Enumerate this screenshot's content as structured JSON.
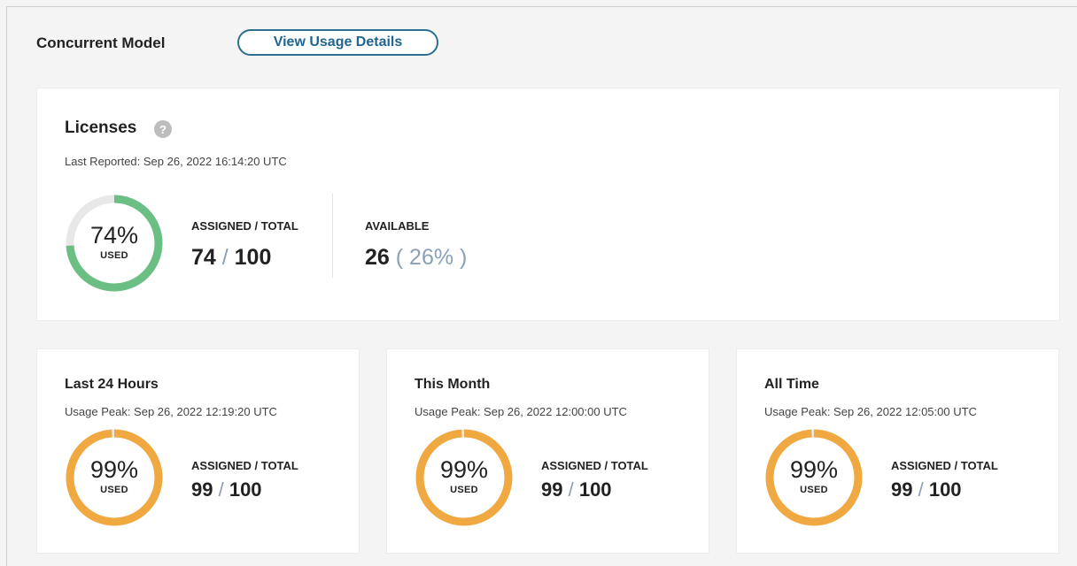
{
  "header": {
    "title": "Concurrent Model",
    "usage_button": "View Usage Details"
  },
  "licenses": {
    "title": "Licenses",
    "help_icon": "help-icon",
    "last_reported": "Last Reported: Sep 26, 2022 16:14:20 UTC",
    "percent": "74%",
    "used_label": "USED",
    "used_fraction": 0.74,
    "ring_color": "#6cbf84",
    "assigned_label": "ASSIGNED / TOTAL",
    "assigned": "74",
    "total": "100",
    "available_label": "AVAILABLE",
    "available": "26",
    "available_pct": "( 26% )"
  },
  "periods": [
    {
      "title": "Last 24 Hours",
      "peak": "Usage Peak: Sep 26, 2022 12:19:20 UTC",
      "percent": "99%",
      "used_label": "USED",
      "used_fraction": 0.99,
      "ring_color": "#f0a840",
      "assigned_label": "ASSIGNED / TOTAL",
      "assigned": "99",
      "total": "100"
    },
    {
      "title": "This Month",
      "peak": "Usage Peak: Sep 26, 2022 12:00:00 UTC",
      "percent": "99%",
      "used_label": "USED",
      "used_fraction": 0.99,
      "ring_color": "#f0a840",
      "assigned_label": "ASSIGNED / TOTAL",
      "assigned": "99",
      "total": "100"
    },
    {
      "title": "All Time",
      "peak": "Usage Peak: Sep 26, 2022 12:05:00 UTC",
      "percent": "99%",
      "used_label": "USED",
      "used_fraction": 0.99,
      "ring_color": "#f0a840",
      "assigned_label": "ASSIGNED / TOTAL",
      "assigned": "99",
      "total": "100"
    }
  ],
  "colors": {
    "ring_track": "#e8e8e8",
    "accent": "#1f6690"
  }
}
